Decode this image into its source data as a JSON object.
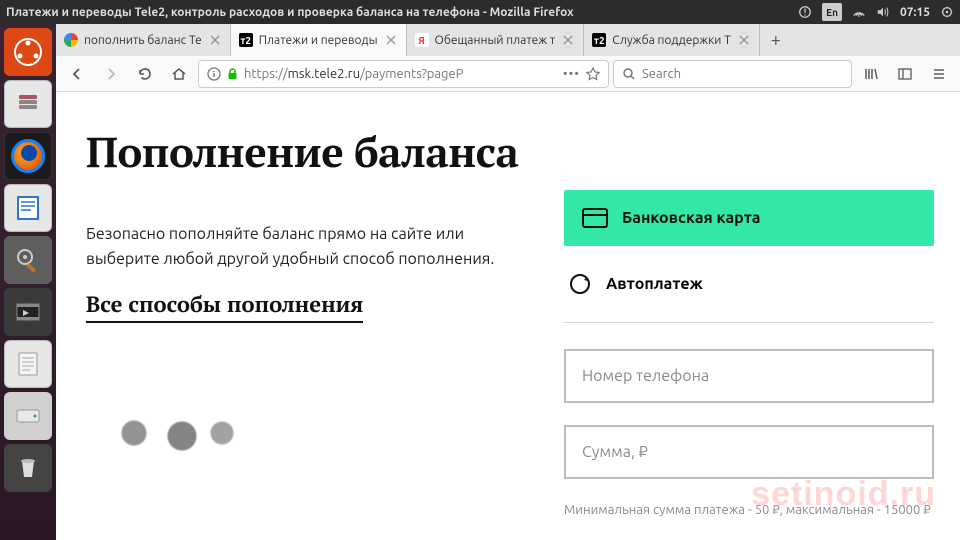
{
  "os": {
    "window_title": "Платежи и переводы Tele2, контроль расходов и проверка баланса на телефона - Mozilla Firefox",
    "lang_indicator": "En",
    "clock": "07:15"
  },
  "browser": {
    "tabs": [
      {
        "label": "пополнить баланс Те",
        "favicon": "google"
      },
      {
        "label": "Платежи и переводы ",
        "favicon": "t2",
        "active": true
      },
      {
        "label": "Обещанный платеж т",
        "favicon": "yandex"
      },
      {
        "label": "Служба поддержки Т",
        "favicon": "t2"
      }
    ],
    "url_prefix": "https://",
    "url_host": "msk.tele2.ru",
    "url_path": "/payments?pageP",
    "search_placeholder": "Search"
  },
  "page": {
    "heading": "Пополнение баланса",
    "lead": "Безопасно пополняйте баланс прямо на сайте или выберите любой другой удобный способ пополнения.",
    "all_methods_link": "Все способы пополнения",
    "method_card": "Банковская карта",
    "method_auto": "Автоплатеж",
    "field_phone_placeholder": "Номер телефона",
    "field_sum_placeholder": "Сумма, ₽",
    "hint": "Минимальная сумма платежа - 50 ₽, максимальная - 15000 ₽"
  },
  "watermark": "setinoid.ru"
}
